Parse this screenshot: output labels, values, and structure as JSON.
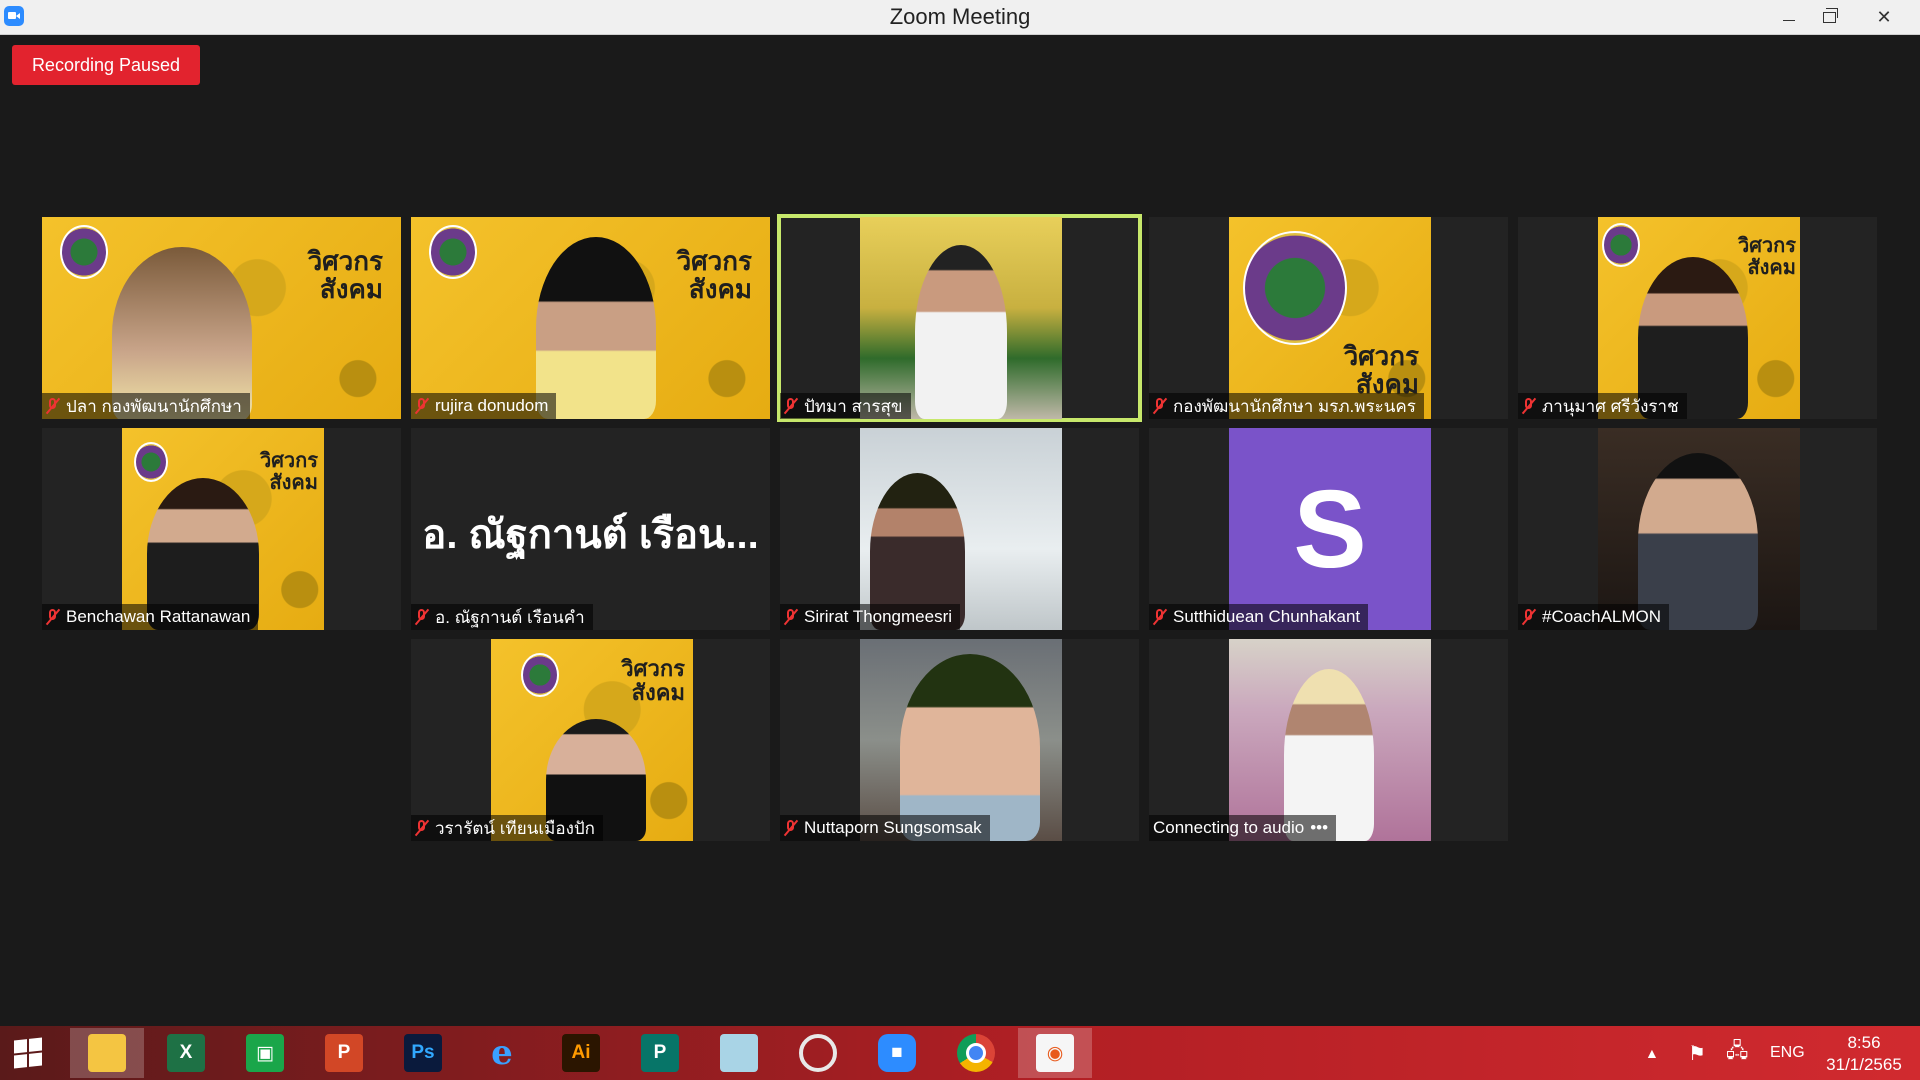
{
  "window": {
    "title": "Zoom Meeting"
  },
  "recording": {
    "label": "Recording Paused"
  },
  "tiles": [
    {
      "name": "ปลา กองพัฒนานักศึกษา",
      "muted": true
    },
    {
      "name": "rujira donudom",
      "muted": true
    },
    {
      "name": "ปัทมา สารสุข",
      "muted": true,
      "active_speaker": true
    },
    {
      "name": "กองพัฒนานักศึกษา มรภ.พระนคร",
      "muted": true
    },
    {
      "name": "ภานุมาศ ศรีวังราช",
      "muted": true
    },
    {
      "name": "Benchawan Rattanawan",
      "muted": true
    },
    {
      "name": "อ. ณัฐกานต์ เรือนคำ",
      "placeholder": "อ. ณัฐกานต์ เรือน...",
      "muted": true
    },
    {
      "name": "Sirirat Thongmeesri",
      "muted": true
    },
    {
      "name": "Sutthiduean Chunhakant",
      "avatar_letter": "S",
      "muted": true
    },
    {
      "name": "#CoachALMON",
      "muted": true
    },
    {
      "name": "วรารัตน์ เทียนเมืองปัก",
      "muted": true
    },
    {
      "name": "Nuttaporn Sungsomsak",
      "muted": true
    },
    {
      "name": "Connecting to audio",
      "status_dots": "•••"
    }
  ],
  "branding": {
    "line1": "วิศวกร",
    "line2": "สังคม"
  },
  "taskbar": {
    "apps": [
      "file-explorer",
      "excel",
      "store",
      "powerpoint",
      "photoshop",
      "internet-explorer",
      "illustrator",
      "publisher",
      "notepad",
      "hoto-scape",
      "zoom",
      "chrome",
      "snagit"
    ],
    "icon_text": {
      "excel": "X",
      "powerpoint": "P",
      "photoshop": "Ps",
      "illustrator": "Ai",
      "publisher": "P"
    },
    "language": "ENG",
    "time": "8:56",
    "date": "31/1/2565"
  },
  "colors": {
    "recording": "#e2232e",
    "active_speaker_border": "#c7e86b",
    "taskbar": "#c2202a",
    "avatar_bg": "#7a53c9"
  }
}
